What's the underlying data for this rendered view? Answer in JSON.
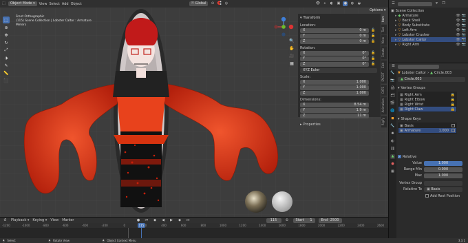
{
  "topbar": {
    "mode": "Object Mode",
    "menus": [
      "View",
      "Select",
      "Add",
      "Object"
    ],
    "transform_orientation": "Global",
    "options_label": "Options"
  },
  "viewport": {
    "view_name": "Front Orthographic",
    "collection_info": "(115) Scene Collection | Lobster Caltor : Armature",
    "units": "Meters"
  },
  "transform_panel": {
    "header": "Transform",
    "location_label": "Location:",
    "location": [
      {
        "axis": "X",
        "value": "0 m"
      },
      {
        "axis": "Y",
        "value": "0 m"
      },
      {
        "axis": "Z",
        "value": "0 m"
      }
    ],
    "rotation_label": "Rotation:",
    "rotation": [
      {
        "axis": "X",
        "value": "0°"
      },
      {
        "axis": "Y",
        "value": "0°"
      },
      {
        "axis": "Z",
        "value": "0°"
      }
    ],
    "rotation_mode": "XYZ Euler",
    "scale_label": "Scale:",
    "scale": [
      {
        "axis": "X",
        "value": "1.000"
      },
      {
        "axis": "Y",
        "value": "1.000"
      },
      {
        "axis": "Z",
        "value": "1.000"
      }
    ],
    "dimensions_label": "Dimensions:",
    "dimensions": [
      {
        "axis": "X",
        "value": "8.54 m"
      },
      {
        "axis": "Y",
        "value": "1.9 m"
      },
      {
        "axis": "Z",
        "value": "11 m"
      }
    ],
    "properties_header": "Properties"
  },
  "npanel_tabs": [
    "Item",
    "Tool",
    "View",
    "Create",
    "Edit",
    "FACEIT",
    "CATS",
    "Animation",
    "Rigify"
  ],
  "outliner": {
    "header": "Scene Collection",
    "items": [
      "Armature",
      "Back Shell",
      "Body Substitute",
      "Left Arm",
      "Lobster Crusher",
      "Lobster Caltor",
      "Right Arm"
    ]
  },
  "properties": {
    "breadcrumb_obj": "Lobster Caltor",
    "breadcrumb_mesh": "Circle.003",
    "mesh_name": "Circle.003",
    "vertex_groups_header": "Vertex Groups",
    "vertex_groups": [
      "Right Arm",
      "Right Elbow",
      "Right Wrist",
      "Right Claw"
    ],
    "shape_keys_header": "Shape Keys",
    "shape_keys": [
      {
        "name": "Basis",
        "value": ""
      },
      {
        "name": "Armature",
        "value": "1.000"
      }
    ],
    "relative_label": "Relative",
    "value_label": "Value",
    "value": "1.000",
    "range_min_label": "Range Min",
    "range_min": "0.000",
    "max_label": "Max",
    "max": "1.000",
    "vertex_group_label": "Vertex Group",
    "relative_to_label": "Relative To",
    "relative_to": "Basis",
    "add_rest_position": "Add Rest Position"
  },
  "timeline": {
    "menus": [
      "Playback",
      "Keying",
      "View",
      "Marker"
    ],
    "current_frame": "115",
    "start_label": "Start",
    "start": "1",
    "end_label": "End",
    "end": "2500",
    "ruler": [
      "-1200",
      "-1000",
      "-800",
      "-600",
      "-400",
      "-200",
      "0",
      "200",
      "400",
      "600",
      "800",
      "1000",
      "1200",
      "1400",
      "1600",
      "1800",
      "2000",
      "2200",
      "2400",
      "2600"
    ]
  },
  "statusbar": {
    "items": [
      "Select",
      "Rotate View",
      "Object Context Menu"
    ],
    "version": "3.3.1"
  }
}
